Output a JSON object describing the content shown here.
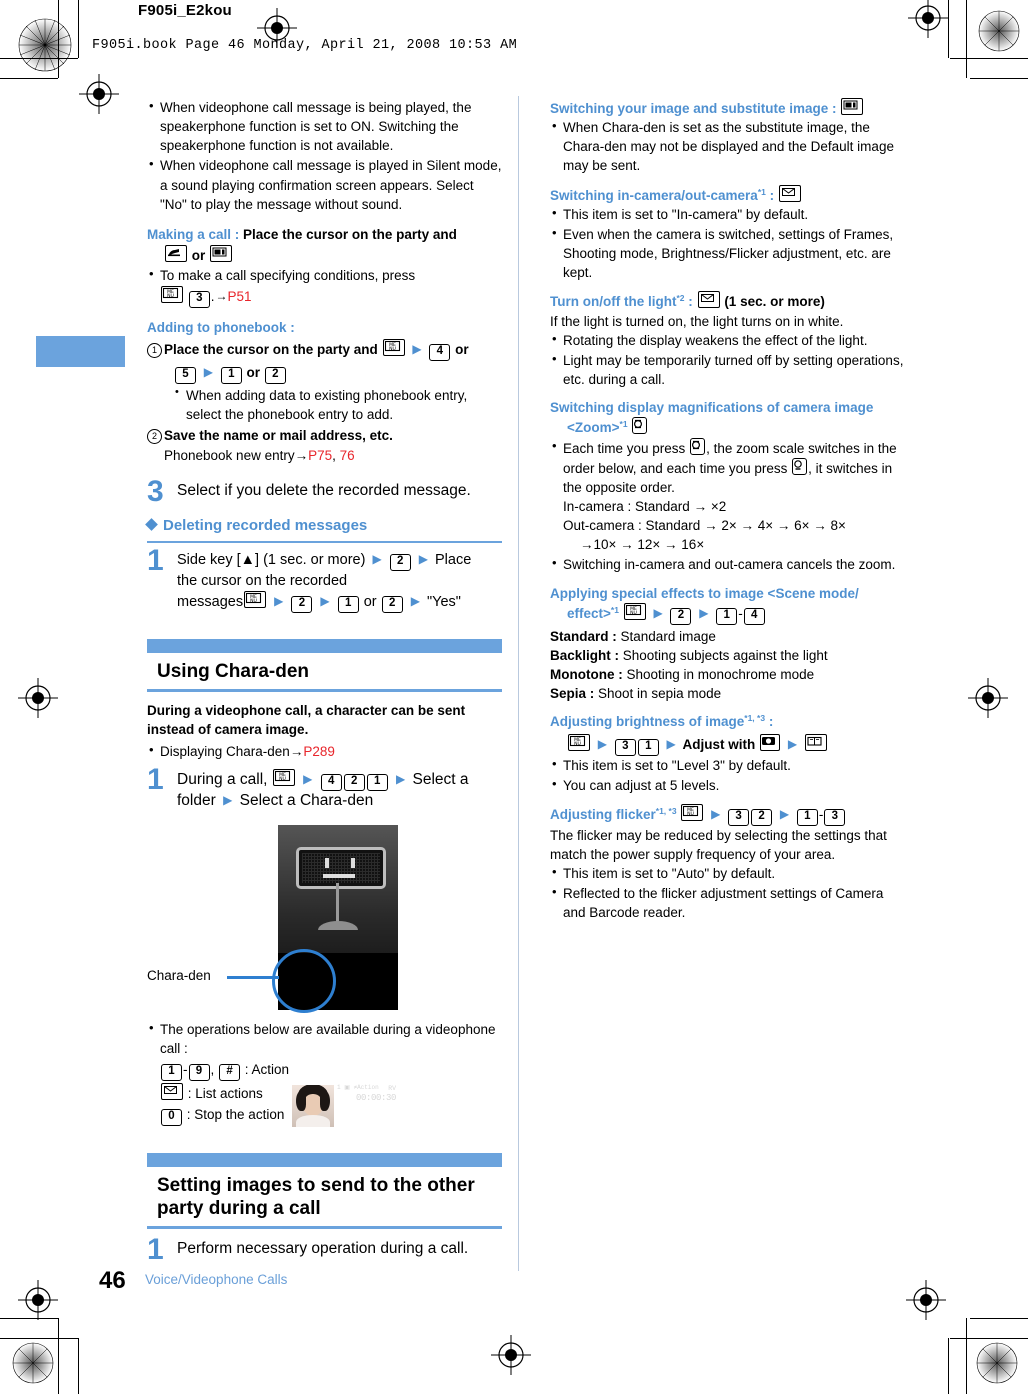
{
  "header": {
    "file_label": "F905i_E2kou",
    "book_line": "F905i.book  Page 46  Monday, April 21, 2008  10:53 AM"
  },
  "footer": {
    "page_number": "46",
    "chapter": "Voice/Videophone Calls"
  },
  "colors": {
    "accent_blue": "#4f90d0",
    "band_blue": "#6ba3dd",
    "link_red": "#e8252b",
    "tab_blue": "#6ba3dd"
  },
  "left_column": {
    "top_notes": [
      "When videophone call message is being played, the speakerphone function is set to ON. Switching the speakerphone function is not available.",
      "When videophone call message is played in Silent mode, a sound playing confirmation screen appears. Select \"No\" to play the message without sound."
    ],
    "making_a_call": {
      "label": "Making a call :",
      "bold_text": "Place the cursor on the party and",
      "key_call": "call-key",
      "or": "or",
      "key_videophone": "videophone-key",
      "note": "To make a call specifying conditions, press",
      "note_keys": [
        "MENU",
        "3"
      ],
      "note_ref": "P51",
      "note_suffix": "."
    },
    "adding_to_phonebook": {
      "label": "Adding to phonebook :",
      "step1_text": "Place the cursor on the party and",
      "step1_keys": [
        "MENU",
        "4",
        "5",
        "1",
        "2"
      ],
      "step1_or1": "or",
      "step1_or2": "or",
      "step1_sub": "When adding data to existing phonebook entry, select the phonebook entry to add.",
      "step2_text": "Save the name or mail address, etc.",
      "step2_sub": "Phonebook new entry",
      "step2_refs": [
        "P75",
        "76"
      ]
    },
    "step3": {
      "num": "3",
      "text": "Select if you delete the recorded message."
    },
    "deleting": {
      "heading": "Deleting recorded messages",
      "step_num": "1",
      "text_a": "Side key [",
      "text_b": "] (1 sec. or more)",
      "text_c": "Place",
      "text_d": "the cursor on the recorded",
      "text_e": "messages",
      "text_f": "or",
      "text_g": "\"Yes\"",
      "keys": [
        "2",
        "MENU",
        "2",
        "1",
        "2"
      ]
    },
    "chara_den_section": {
      "title": "Using Chara-den",
      "intro": "During a videophone call, a character can be sent instead of camera image.",
      "bullet_text": "Displaying Chara-den",
      "bullet_ref": "P289",
      "step_num": "1",
      "step_a": "During a call,",
      "step_keys": [
        "MENU",
        "4",
        "2",
        "1"
      ],
      "step_b": "Select a",
      "step_c": "folder",
      "step_d": "Select a Chara-den",
      "figure": {
        "caption": "Chara-den",
        "screen_status_left": "1",
        "screen_status_mid": "≠Action",
        "screen_status_right": "RV",
        "screen_timer": "00:00:30"
      },
      "ops_note": "The operations below are available during a videophone call :",
      "ops": [
        {
          "keys": [
            "1",
            "9"
          ],
          "sep": "-",
          "extra_key": "#",
          "label": ": Action"
        },
        {
          "keys": [
            "mail"
          ],
          "label": ": List actions"
        },
        {
          "keys": [
            "0"
          ],
          "label": ": Stop the action"
        }
      ]
    },
    "setting_images_section": {
      "title": "Setting images to send to the other party during a call",
      "step_num": "1",
      "step_text": "Perform necessary operation during a call."
    }
  },
  "right_column": {
    "switching_image": {
      "heading": "Switching your image and substitute image :",
      "key": "videophone-key",
      "bullets": [
        "When Chara-den is set as the substitute image, the Chara-den may not be displayed and the Default image may be sent."
      ]
    },
    "switching_camera": {
      "heading": "Switching in-camera/out-camera",
      "sup": "*1",
      "colon": ":",
      "key": "mail-key",
      "bullets": [
        "This item is set to \"In-camera\" by default.",
        "Even when the camera is switched, settings of Frames, Shooting mode, Brightness/Flicker adjustment, etc. are kept."
      ]
    },
    "light": {
      "heading": "Turn on/off the light",
      "sup": "*2",
      "colon": ":",
      "key": "mail-key",
      "suffix": "(1 sec. or more)",
      "body": "If the light is turned on, the light turns on in white.",
      "bullets": [
        "Rotating the display weakens the effect of the light.",
        "Light may be temporarily turned off by setting operations, etc. during a call."
      ]
    },
    "zoom": {
      "heading_line1": "Switching display magnifications of camera image",
      "heading_line2": "<Zoom>",
      "sup": "*1",
      "key": "zoom-up-key",
      "bullet_a": "Each time you press",
      "bullet_b": ", the zoom scale switches in the order below, and each time you press",
      "bullet_c": ", it switches in the opposite order.",
      "in_camera": "In-camera : Standard → ×2",
      "out_camera": "Out-camera : Standard → 2×  → 4×  → 6×  → 8×",
      "out_camera2": "→10×  → 12×  → 16×",
      "bullet_last": "Switching in-camera and out-camera cancels the zoom."
    },
    "scene_mode": {
      "heading_line1": "Applying special effects to image <Scene mode/",
      "heading_line2": "effect>",
      "sup": "*1",
      "keys": [
        "MENU",
        "2",
        "1",
        "4"
      ],
      "sep": "-",
      "items": [
        {
          "term": "Standard :",
          "def": "Standard image"
        },
        {
          "term": "Backlight :",
          "def": "Shooting subjects against the light"
        },
        {
          "term": "Monotone :",
          "def": "Shooting in monochrome mode"
        },
        {
          "term": "Sepia :",
          "def": "Shoot in sepia mode"
        }
      ]
    },
    "brightness": {
      "heading": "Adjusting brightness of image",
      "sup": "*1, *3",
      "colon": ":",
      "keys": [
        "MENU",
        "3",
        "1"
      ],
      "adjust_text": "Adjust with",
      "adjust_key": "dpad-key",
      "confirm_key": "book-key",
      "bullets": [
        "This item is set to \"Level 3\" by default.",
        "You can adjust at 5 levels."
      ]
    },
    "flicker": {
      "heading": "Adjusting flicker",
      "sup": "*1, *3",
      "keys": [
        "MENU",
        "3",
        "2",
        "1",
        "3"
      ],
      "sep": "-",
      "body": "The flicker may be reduced by selecting the settings that match the power supply frequency of your area.",
      "bullets": [
        "This item is set to \"Auto\" by default.",
        "Reflected to the flicker adjustment settings of Camera and Barcode reader."
      ]
    }
  }
}
